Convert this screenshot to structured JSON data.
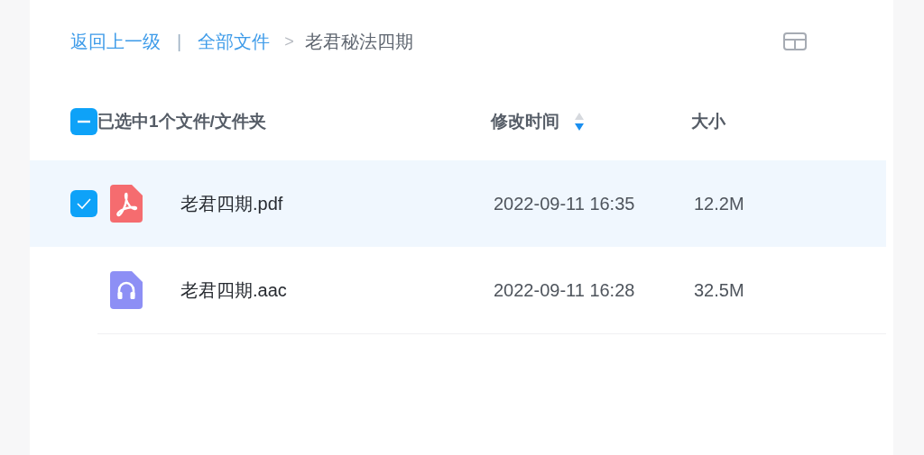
{
  "breadcrumb": {
    "back": "返回上一级",
    "separator": "|",
    "root": "全部文件",
    "arrow": ">",
    "current": "老君秘法四期"
  },
  "header": {
    "select_all": {
      "label": "已选中1个文件/文件夹",
      "indeterminate": true
    },
    "columns": [
      {
        "label": "修改时间",
        "sortable": true,
        "descending": true
      },
      {
        "label": "大小",
        "sortable": false
      }
    ]
  },
  "rows": [
    {
      "kind": "pdf",
      "name": "老君四期.pdf",
      "modified": "2022-09-11 16:35",
      "size": "12.2M",
      "selected": true,
      "checked": true
    },
    {
      "kind": "audio",
      "name": "老君四期.aac",
      "modified": "2022-09-11 16:28",
      "size": "32.5M",
      "selected": false,
      "checked": false
    }
  ]
}
